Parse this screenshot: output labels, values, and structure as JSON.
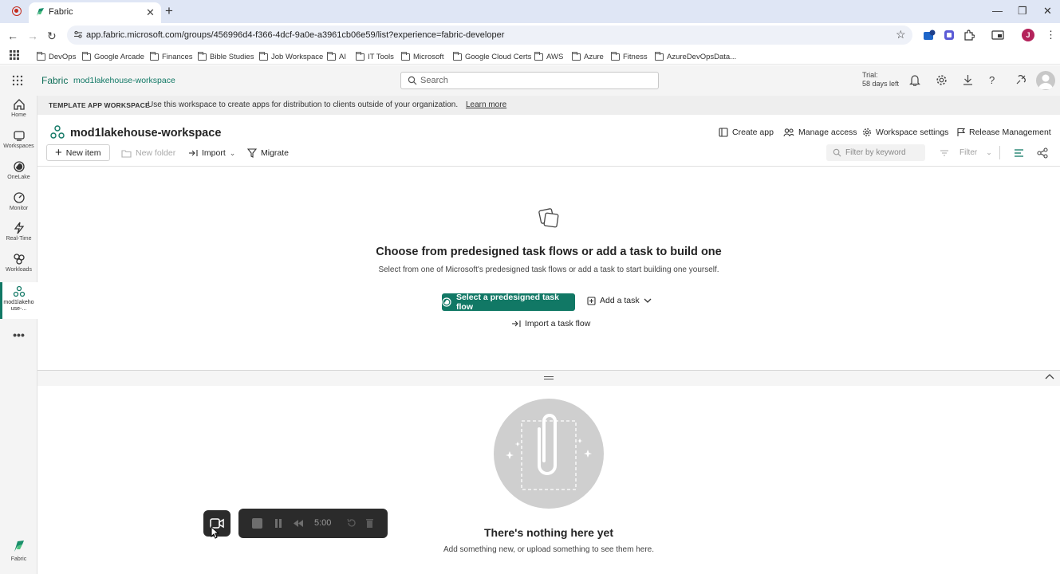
{
  "browser": {
    "tab_title": "Fabric",
    "url": "app.fabric.microsoft.com/groups/456996d4-f366-4dcf-9a0e-a3961cb06e59/list?experience=fabric-developer",
    "profile_initial": "J",
    "bookmarks": [
      "DevOps",
      "Google Arcade",
      "Finances",
      "Bible Studies",
      "Job Workspace",
      "AI",
      "IT Tools",
      "Microsoft",
      "Google Cloud Certs",
      "AWS",
      "Azure",
      "Fitness",
      "AzureDevOpsData..."
    ]
  },
  "header": {
    "brand": "Fabric",
    "workspace": "mod1lakehouse-workspace",
    "search_placeholder": "Search",
    "trial_line1": "Trial:",
    "trial_line2": "58 days left"
  },
  "rail": {
    "items": [
      {
        "label": "Home",
        "icon": "home-icon"
      },
      {
        "label": "Workspaces",
        "icon": "workspaces-icon"
      },
      {
        "label": "OneLake",
        "icon": "onelake-icon"
      },
      {
        "label": "Monitor",
        "icon": "monitor-icon"
      },
      {
        "label": "Real-Time",
        "icon": "realtime-icon"
      },
      {
        "label": "Workloads",
        "icon": "workloads-icon"
      },
      {
        "label_line1": "mod1lakeho",
        "label_line2": "use-...",
        "icon": "workspace-icon"
      }
    ],
    "bottom_label": "Fabric"
  },
  "banner": {
    "tag": "TEMPLATE APP WORKSPACE",
    "text": "Use this workspace to create apps for distribution to clients outside of your organization.",
    "link": "Learn more"
  },
  "workspace": {
    "title": "mod1lakehouse-workspace",
    "actions": [
      "Create app",
      "Manage access",
      "Workspace settings",
      "Release Management"
    ],
    "commands": {
      "new_item": "New item",
      "new_folder": "New folder",
      "import": "Import",
      "migrate": "Migrate"
    },
    "filter_placeholder": "Filter by keyword",
    "filter_label": "Filter"
  },
  "task_flow": {
    "heading": "Choose from predesigned task flows or add a task to build one",
    "subheading": "Select from one of Microsoft's predesigned task flows or add a task to start building one yourself.",
    "primary_button": "Select a predesigned task flow",
    "add_task": "Add a task",
    "import_flow": "Import a task flow"
  },
  "empty_state": {
    "title": "There's nothing here yet",
    "subtitle": "Add something new, or upload something to see them here."
  },
  "recorder": {
    "time": "5:00"
  },
  "colors": {
    "accent": "#117865",
    "tabbar": "#dfe6f5",
    "recorder": "#2b2b2b"
  }
}
